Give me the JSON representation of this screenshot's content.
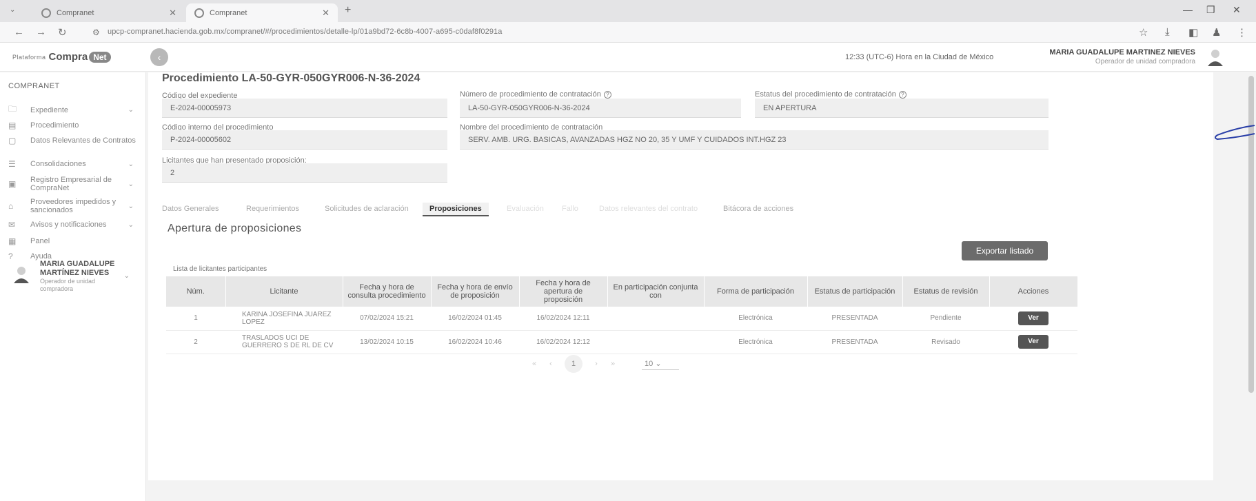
{
  "browser": {
    "tabs": [
      {
        "title": "Compranet",
        "active": false
      },
      {
        "title": "Compranet",
        "active": true
      }
    ],
    "url": "upcp-compranet.hacienda.gob.mx/compranet/#/procedimientos/detalle-lp/01a9bd72-6c8b-4007-a695-c0daf8f0291a"
  },
  "header": {
    "logo_small": "Plataforma",
    "logo_main": "Compra",
    "logo_pill": "Net",
    "clock": "12:33 (UTC-6) Hora en la Ciudad de México",
    "user_name": "MARIA GUADALUPE MARTINEZ NIEVES",
    "user_role": "Operador de unidad compradora"
  },
  "sidebar": {
    "title": "COMPRANET",
    "items": [
      {
        "label": "Expediente",
        "icon": "folder-icon",
        "expandable": true
      },
      {
        "label": "Procedimiento",
        "icon": "document-icon",
        "expandable": false
      },
      {
        "label": "Datos Relevantes de Contratos",
        "icon": "chat-icon",
        "expandable": false
      },
      {
        "label": "Consolidaciones",
        "icon": "stack-icon",
        "expandable": true
      },
      {
        "label": "Registro Empresarial de CompraNet",
        "icon": "id-card-icon",
        "expandable": true
      },
      {
        "label": "Proveedores impedidos y sancionados",
        "icon": "store-icon",
        "expandable": true
      },
      {
        "label": "Avisos y notificaciones",
        "icon": "mail-icon",
        "expandable": true
      },
      {
        "label": "Panel",
        "icon": "grid-icon",
        "expandable": false
      },
      {
        "label": "Ayuda",
        "icon": "help-icon",
        "expandable": false
      }
    ],
    "user": {
      "name": "MARIA GUADALUPE MARTÍNEZ NIEVES",
      "role": "Operador de unidad compradora"
    }
  },
  "procedure": {
    "title": "Procedimiento LA-50-GYR-050GYR006-N-36-2024",
    "fields": {
      "codigo_expediente": {
        "label": "Código del expediente",
        "value": "E-2024-00005973"
      },
      "numero_procedimiento": {
        "label": "Número de procedimiento de contratación",
        "value": "LA-50-GYR-050GYR006-N-36-2024"
      },
      "estatus_procedimiento": {
        "label": "Estatus del procedimiento de contratación",
        "value": "EN APERTURA"
      },
      "codigo_interno": {
        "label": "Código interno del procedimiento",
        "value": "P-2024-00005602"
      },
      "nombre_procedimiento": {
        "label": "Nombre del procedimiento de contratación",
        "value": "SERV. AMB. URG. BASICAS, AVANZADAS HGZ NO 20, 35 Y UMF Y CUIDADOS INT.HGZ 23"
      },
      "licitantes": {
        "label": "Licitantes que han presentado proposición:",
        "value": "2"
      }
    }
  },
  "tabs": [
    {
      "label": "Datos Generales",
      "state": "normal"
    },
    {
      "label": "Requerimientos",
      "state": "normal"
    },
    {
      "label": "Solicitudes de aclaración",
      "state": "normal"
    },
    {
      "label": "Proposiciones",
      "state": "active"
    },
    {
      "label": "Evaluación",
      "state": "faint"
    },
    {
      "label": "Fallo",
      "state": "faint"
    },
    {
      "label": "Datos relevantes del contrato",
      "state": "faint"
    },
    {
      "label": "Bitácora de acciones",
      "state": "normal"
    }
  ],
  "proposiciones": {
    "section_title": "Apertura de proposiciones",
    "export_label": "Exportar listado",
    "list_caption": "Lista de licitantes participantes",
    "columns": [
      "Núm.",
      "Licitante",
      "Fecha y hora de consulta procedimiento",
      "Fecha y hora de envío de proposición",
      "Fecha y hora de apertura de proposición",
      "En participación conjunta con",
      "Forma de participación",
      "Estatus de participación",
      "Estatus de revisión",
      "Acciones"
    ],
    "rows": [
      {
        "num": "1",
        "licitante": "KARINA JOSEFINA JUAREZ LOPEZ",
        "consulta": "07/02/2024 15:21",
        "envio": "16/02/2024 01:45",
        "apertura": "16/02/2024 12:11",
        "conjunta": "",
        "forma": "Electrónica",
        "estatus_part": "PRESENTADA",
        "estatus_rev": "Pendiente",
        "accion": "Ver"
      },
      {
        "num": "2",
        "licitante": "TRASLADOS UCI DE GUERRERO S DE RL DE CV",
        "consulta": "13/02/2024 10:15",
        "envio": "16/02/2024 10:46",
        "apertura": "16/02/2024 12:12",
        "conjunta": "",
        "forma": "Electrónica",
        "estatus_part": "PRESENTADA",
        "estatus_rev": "Revisado",
        "accion": "Ver"
      }
    ],
    "pagination": {
      "current_page": "1",
      "page_size": "10"
    }
  }
}
